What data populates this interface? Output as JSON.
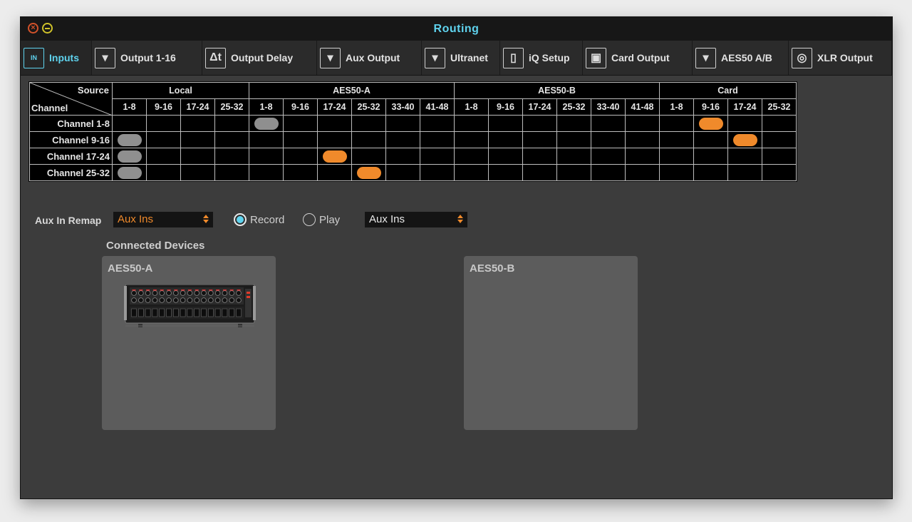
{
  "window": {
    "title": "Routing"
  },
  "tabs": [
    {
      "label": "Inputs",
      "icon": "input-jack-icon",
      "glyph": "IN",
      "active": true
    },
    {
      "label": "Output 1-16",
      "icon": "output-jack-icon",
      "glyph": "▾",
      "active": false
    },
    {
      "label": "Output Delay",
      "icon": "delta-t-icon",
      "glyph": "Δt",
      "active": false
    },
    {
      "label": "Aux Output",
      "icon": "output-jack-icon",
      "glyph": "▾",
      "active": false
    },
    {
      "label": "Ultranet",
      "icon": "output-jack-icon",
      "glyph": "▾",
      "active": false
    },
    {
      "label": "iQ Setup",
      "icon": "speaker-icon",
      "glyph": "▯",
      "active": false
    },
    {
      "label": "Card Output",
      "icon": "card-icon",
      "glyph": "▣",
      "active": false
    },
    {
      "label": "AES50 A/B",
      "icon": "output-jack-icon",
      "glyph": "▾",
      "active": false
    },
    {
      "label": "XLR Output",
      "icon": "xlr-connector-icon",
      "glyph": "◎",
      "active": false
    }
  ],
  "routing_grid": {
    "corner_source": "Source",
    "corner_channel": "Channel",
    "groups": [
      {
        "label": "Local",
        "columns": [
          "1-8",
          "9-16",
          "17-24",
          "25-32"
        ]
      },
      {
        "label": "AES50-A",
        "columns": [
          "1-8",
          "9-16",
          "17-24",
          "25-32",
          "33-40",
          "41-48"
        ]
      },
      {
        "label": "AES50-B",
        "columns": [
          "1-8",
          "9-16",
          "17-24",
          "25-32",
          "33-40",
          "41-48"
        ]
      },
      {
        "label": "Card",
        "columns": [
          "1-8",
          "9-16",
          "17-24",
          "25-32"
        ]
      }
    ],
    "rows": [
      {
        "label": "Channel 1-8",
        "selected_col": 4,
        "state": "gray"
      },
      {
        "label": "Channel 9-16",
        "selected_col": 0,
        "state": "gray"
      },
      {
        "label": "Channel 17-24",
        "selected_col": 0,
        "state": "gray"
      },
      {
        "label": "Channel 25-32",
        "selected_col": 0,
        "state": "gray"
      }
    ],
    "highlights": [
      {
        "row": 0,
        "col": 17,
        "state": "orange"
      },
      {
        "row": 1,
        "col": 18,
        "state": "orange"
      },
      {
        "row": 2,
        "col": 6,
        "state": "orange"
      },
      {
        "row": 3,
        "col": 7,
        "state": "orange"
      }
    ]
  },
  "aux_in_remap": {
    "label": "Aux In Remap",
    "remap_value": "Aux Ins",
    "record_label": "Record",
    "play_label": "Play",
    "mode": "Record",
    "source_value": "Aux Ins"
  },
  "connected_devices": {
    "title": "Connected Devices",
    "devices": [
      {
        "name": "AES50-A",
        "has_device": true
      },
      {
        "name": "AES50-B",
        "has_device": false
      }
    ]
  },
  "colors": {
    "accent": "#5fd3ee",
    "orange": "#f08a2b",
    "gray_pill": "#8f8f8f",
    "background": "#3c3c3c"
  }
}
